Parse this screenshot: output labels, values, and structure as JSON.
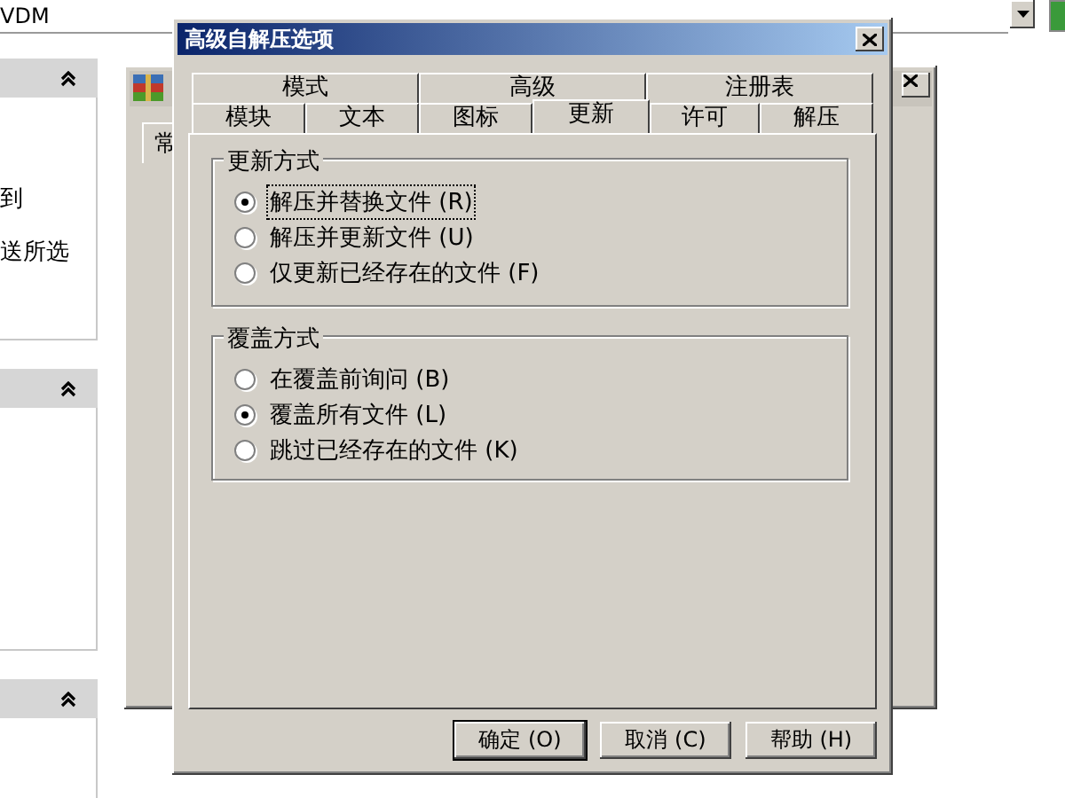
{
  "address_bar": {
    "value": "VDM"
  },
  "sidebar": {
    "panels": [
      {
        "expanded": true,
        "lines": [
          "到",
          "送所选"
        ]
      },
      {
        "expanded": true
      },
      {
        "expanded": true
      }
    ]
  },
  "back_window": {
    "tab": "常"
  },
  "dialog": {
    "title": "高级自解压选项",
    "tab_rows": [
      [
        {
          "label": "模式",
          "selected": false
        },
        {
          "label": "高级",
          "selected": false
        },
        {
          "label": "注册表",
          "selected": false
        }
      ],
      [
        {
          "label": "模块",
          "selected": false
        },
        {
          "label": "文本",
          "selected": false
        },
        {
          "label": "图标",
          "selected": false
        },
        {
          "label": "更新",
          "selected": true
        },
        {
          "label": "许可",
          "selected": false
        },
        {
          "label": "解压",
          "selected": false
        }
      ]
    ],
    "groups": [
      {
        "title": "更新方式",
        "options": [
          {
            "label": "解压并替换文件 (R)",
            "selected": true,
            "focused": true
          },
          {
            "label": "解压并更新文件 (U)",
            "selected": false,
            "focused": false
          },
          {
            "label": "仅更新已经存在的文件 (F)",
            "selected": false,
            "focused": false
          }
        ]
      },
      {
        "title": "覆盖方式",
        "options": [
          {
            "label": "在覆盖前询问 (B)",
            "selected": false,
            "focused": false
          },
          {
            "label": "覆盖所有文件 (L)",
            "selected": true,
            "focused": false
          },
          {
            "label": "跳过已经存在的文件 (K)",
            "selected": false,
            "focused": false
          }
        ]
      }
    ],
    "buttons": [
      {
        "label": "确定 (O)",
        "default": true
      },
      {
        "label": "取消 (C)",
        "default": false
      },
      {
        "label": "帮助 (H)",
        "default": false
      }
    ]
  }
}
